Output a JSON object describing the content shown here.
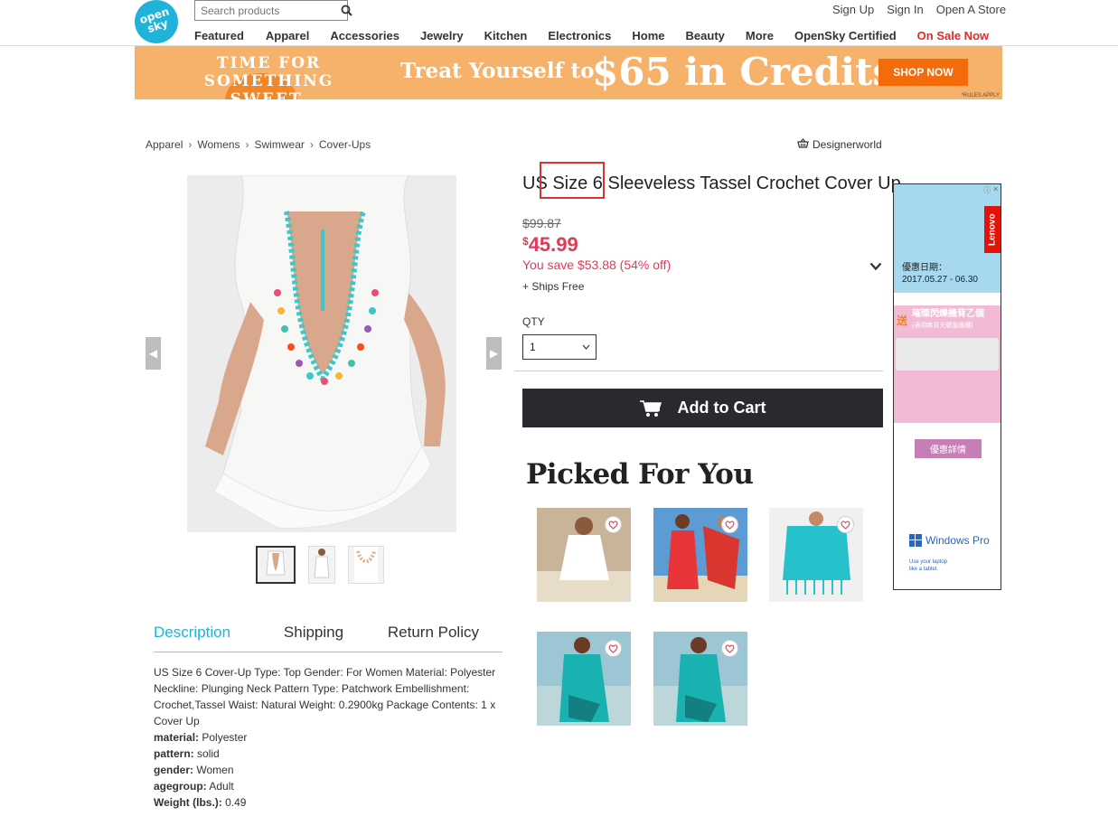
{
  "header": {
    "logo_text": "open sky",
    "search_placeholder": "Search products",
    "account_links": [
      "Sign Up",
      "Sign In",
      "Open A Store"
    ],
    "nav": [
      {
        "label": "Featured",
        "color": "#333333"
      },
      {
        "label": "Apparel",
        "color": "#333333"
      },
      {
        "label": "Accessories",
        "color": "#333333"
      },
      {
        "label": "Jewelry",
        "color": "#333333"
      },
      {
        "label": "Kitchen",
        "color": "#333333"
      },
      {
        "label": "Electronics",
        "color": "#333333"
      },
      {
        "label": "Home",
        "color": "#333333"
      },
      {
        "label": "Beauty",
        "color": "#333333"
      },
      {
        "label": "More",
        "color": "#333333"
      },
      {
        "label": "OpenSky Certified",
        "color": "#333333"
      },
      {
        "label": "On Sale Now",
        "color": "#e02b2b"
      }
    ]
  },
  "banner": {
    "left_line1": "TIME FOR",
    "left_line2": "SOMETHING SWEET.",
    "middle": "Treat Yourself to",
    "amount": "$65 in Credits",
    "cta": "SHOP NOW",
    "rules": "*RULES APPLY"
  },
  "breadcrumb": [
    "Apparel",
    "Womens",
    "Swimwear",
    "Cover-Ups"
  ],
  "store_name": "Designerworld",
  "product": {
    "title": "US Size 6 Sleeveless Tassel Crochet Cover Up",
    "old_price": "$99.87",
    "currency": "$",
    "price": "45.99",
    "savings": "You save $53.88 (54% off)",
    "shipping": "+ Ships Free",
    "qty_label": "QTY",
    "qty_value": "1",
    "add_to_cart": "Add to Cart",
    "accent_color": "#e03a57"
  },
  "tabs": [
    "Description",
    "Shipping",
    "Return Policy"
  ],
  "description": {
    "text": "US Size 6 Cover-Up Type: Top Gender: For Women Material: Polyester Neckline: Plunging Neck Pattern Type: Patchwork Embellishment: Crochet,Tassel Waist: Natural Weight: 0.2900kg Package Contents: 1 x Cover Up",
    "attributes": [
      {
        "key": "material:",
        "value": "Polyester"
      },
      {
        "key": "pattern:",
        "value": "solid"
      },
      {
        "key": "gender:",
        "value": "Women"
      },
      {
        "key": "agegroup:",
        "value": "Adult"
      },
      {
        "key": "Weight (lbs.):",
        "value": "0.49"
      }
    ]
  },
  "picked": {
    "title": "Picked For You",
    "items": [
      {
        "name": "white-kaftan"
      },
      {
        "name": "red-wrap-dress"
      },
      {
        "name": "turquoise-fringe-coverup"
      },
      {
        "name": "teal-wrap-sarong"
      },
      {
        "name": "teal-wrap-sarong-2"
      }
    ]
  },
  "ad": {
    "brand": "Lenovo",
    "date_label": "優惠日期：",
    "date_range": "2017.05.27 - 06.30",
    "gift_char": "送",
    "promo": "璀璨閃爍機背乙個",
    "promo_sub": "(適用無背光鍵盤機種)",
    "button": "優惠詳情",
    "windows": "Windows Pro",
    "windows_sub1": "Use your laptop",
    "windows_sub2": "like a tablet."
  }
}
